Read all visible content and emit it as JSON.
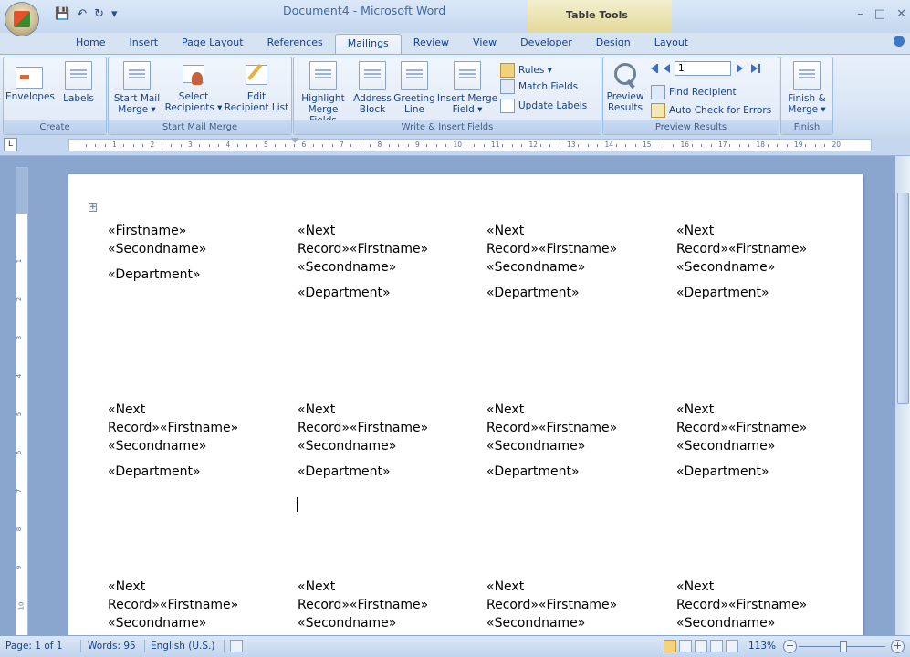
{
  "window": {
    "title": "Document4 - Microsoft Word",
    "context_tab": "Table Tools"
  },
  "tabs": [
    {
      "label": "Home"
    },
    {
      "label": "Insert"
    },
    {
      "label": "Page Layout"
    },
    {
      "label": "References"
    },
    {
      "label": "Mailings"
    },
    {
      "label": "Review"
    },
    {
      "label": "View"
    },
    {
      "label": "Developer"
    },
    {
      "label": "Design"
    },
    {
      "label": "Layout"
    }
  ],
  "ribbon": {
    "create": {
      "label": "Create",
      "envelopes": "Envelopes",
      "labels": "Labels"
    },
    "start_mail_merge": {
      "label": "Start Mail Merge",
      "start_line1": "Start Mail",
      "start_line2": "Merge ▾",
      "select_line1": "Select",
      "select_line2": "Recipients ▾",
      "edit_line1": "Edit",
      "edit_line2": "Recipient List"
    },
    "write_insert": {
      "label": "Write & Insert Fields",
      "highlight_line1": "Highlight",
      "highlight_line2": "Merge Fields",
      "address_line1": "Address",
      "address_line2": "Block",
      "greeting_line1": "Greeting",
      "greeting_line2": "Line",
      "insert_line1": "Insert Merge",
      "insert_line2": "Field ▾",
      "rules": "Rules ▾",
      "match_fields": "Match Fields",
      "update_labels": "Update Labels"
    },
    "preview": {
      "label": "Preview Results",
      "preview_line1": "Preview",
      "preview_line2": "Results",
      "record_number": "1",
      "find_recipient": "Find Recipient",
      "auto_check": "Auto Check for Errors"
    },
    "finish": {
      "label": "Finish",
      "finish_line1": "Finish &",
      "finish_line2": "Merge ▾"
    }
  },
  "ruler": {
    "numbers": [
      "1",
      "2",
      "3",
      "4",
      "5",
      "6",
      "7",
      "8",
      "9",
      "10",
      "11",
      "12",
      "13",
      "14",
      "15",
      "16",
      "17",
      "18",
      "19",
      "20"
    ],
    "vertical_numbers": [
      "1",
      "2",
      "3",
      "4",
      "5",
      "6",
      "7",
      "8",
      "9",
      "10",
      "11"
    ]
  },
  "document": {
    "cells": [
      {
        "line1": "«Firstname»",
        "line2": "«Secondname»",
        "line3": "",
        "dept": "«Department»"
      },
      {
        "line1": "«Next",
        "line2": "Record»«Firstname»",
        "line3": "«Secondname»",
        "dept": "«Department»"
      },
      {
        "line1": "«Next",
        "line2": "Record»«Firstname»",
        "line3": "«Secondname»",
        "dept": "«Department»"
      },
      {
        "line1": "«Next",
        "line2": "Record»«Firstname»",
        "line3": "«Secondname»",
        "dept": "«Department»"
      },
      {
        "line1": "«Next",
        "line2": "Record»«Firstname»",
        "line3": "«Secondname»",
        "dept": "«Department»"
      },
      {
        "line1": "«Next",
        "line2": "Record»«Firstname»",
        "line3": "«Secondname»",
        "dept": "«Department»"
      },
      {
        "line1": "«Next",
        "line2": "Record»«Firstname»",
        "line3": "«Secondname»",
        "dept": "«Department»"
      },
      {
        "line1": "«Next",
        "line2": "Record»«Firstname»",
        "line3": "«Secondname»",
        "dept": "«Department»"
      },
      {
        "line1": "«Next",
        "line2": "Record»«Firstname»",
        "line3": "«Secondname»",
        "dept": ""
      },
      {
        "line1": "«Next",
        "line2": "Record»«Firstname»",
        "line3": "«Secondname»",
        "dept": ""
      },
      {
        "line1": "«Next",
        "line2": "Record»«Firstname»",
        "line3": "«Secondname»",
        "dept": ""
      },
      {
        "line1": "«Next",
        "line2": "Record»«Firstname»",
        "line3": "«Secondname»",
        "dept": ""
      }
    ]
  },
  "status": {
    "page": "Page: 1 of 1",
    "words": "Words: 95",
    "language": "English (U.S.)",
    "zoom": "113%"
  },
  "icons": [
    "office-button-icon",
    "save-icon",
    "undo-icon",
    "redo-icon",
    "envelope-icon",
    "label-icon",
    "mail-merge-icon",
    "recipients-icon",
    "edit-list-icon",
    "highlight-icon",
    "address-block-icon",
    "greeting-line-icon",
    "insert-field-icon",
    "rules-icon",
    "match-fields-icon",
    "update-labels-icon",
    "preview-icon",
    "find-recipient-icon",
    "auto-check-icon",
    "finish-merge-icon"
  ]
}
